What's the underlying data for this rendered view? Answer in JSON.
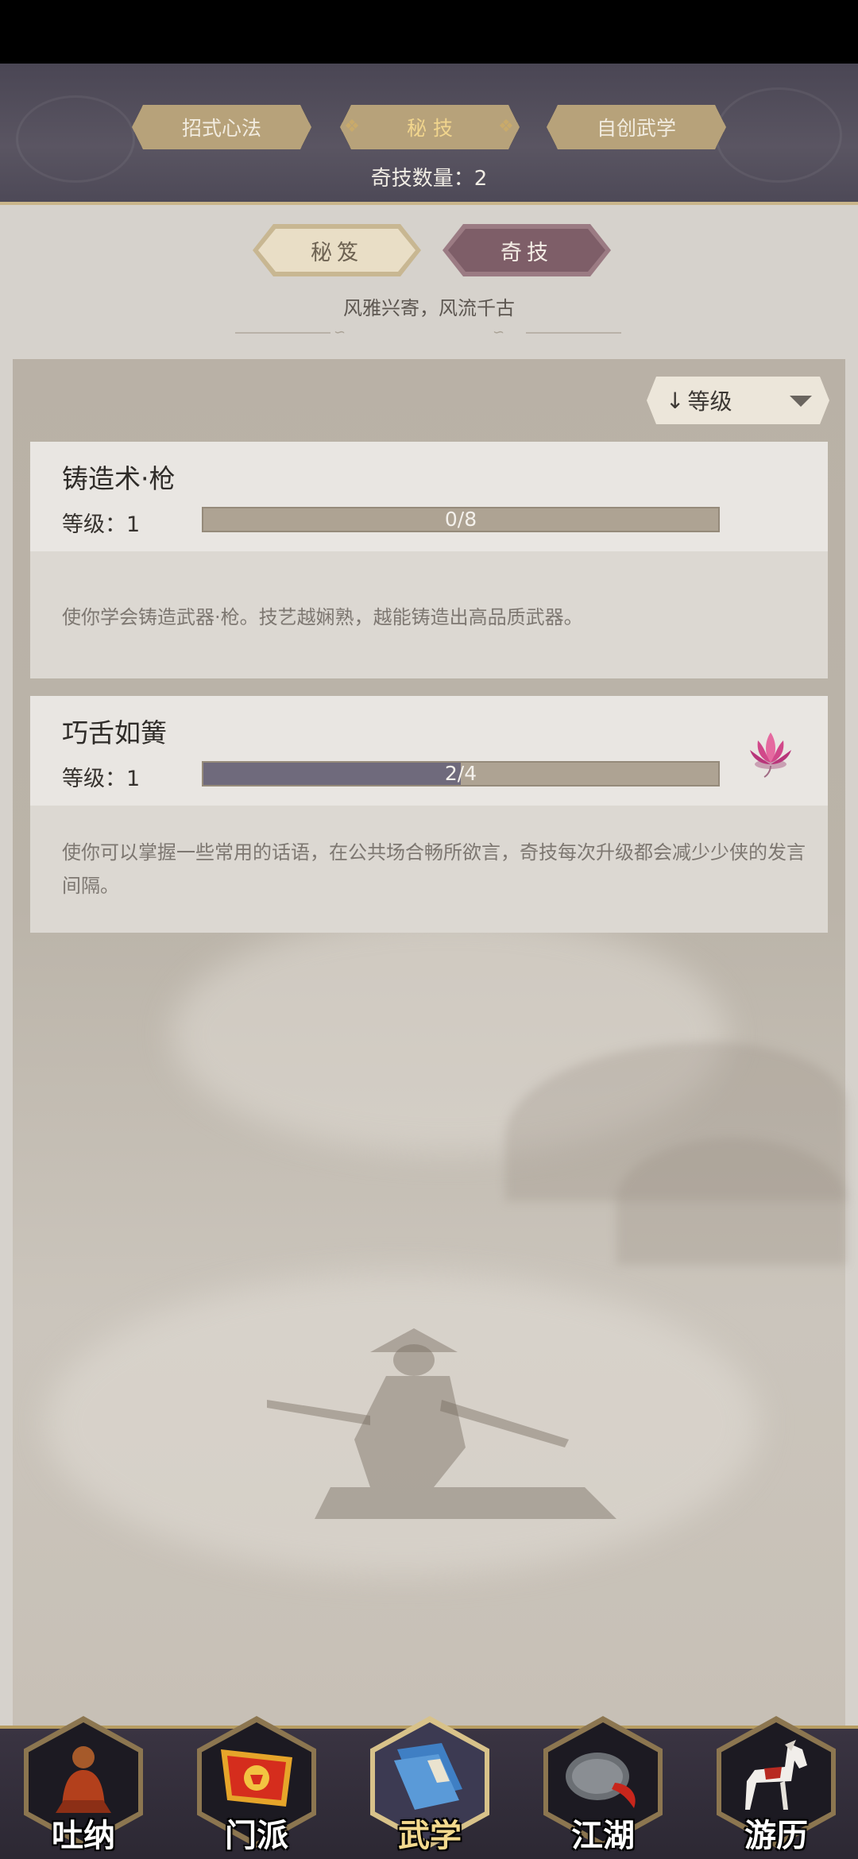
{
  "header": {
    "tabs": [
      {
        "label": "招式心法",
        "active": false
      },
      {
        "label": "秘 技",
        "active": true
      },
      {
        "label": "自创武学",
        "active": false
      }
    ],
    "count_text": "奇技数量：2"
  },
  "sub_tabs": [
    {
      "label": "秘笈",
      "active": false
    },
    {
      "label": "奇技",
      "active": true
    }
  ],
  "subtitle": "风雅兴寄，风流千古",
  "sort": {
    "label": "等级",
    "arrow": "↓"
  },
  "skills": [
    {
      "name": "铸造术·枪",
      "level_text": "等级：1",
      "progress_text": "0/8",
      "progress": 0.0,
      "description": "使你学会铸造武器·枪。技艺越娴熟，越能铸造出高品质武器。",
      "icon": null
    },
    {
      "name": "巧舌如簧",
      "level_text": "等级：1",
      "progress_text": "2/4",
      "progress": 0.5,
      "description": "使你可以掌握一些常用的话语，在公共场合畅所欲言，奇技每次升级都会减少少侠的发言间隔。",
      "icon": "lotus-icon"
    }
  ],
  "bottom_nav": [
    {
      "label": "吐纳",
      "icon": "meditating-monk-icon",
      "active": false
    },
    {
      "label": "门派",
      "icon": "sect-banner-icon",
      "active": false
    },
    {
      "label": "武学",
      "icon": "martial-book-icon",
      "active": true
    },
    {
      "label": "江湖",
      "icon": "bamboo-hat-icon",
      "active": false
    },
    {
      "label": "游历",
      "icon": "horse-icon",
      "active": false
    }
  ],
  "colors": {
    "header_bg": "#4a4654",
    "accent_gold": "#c9b58a",
    "active_subtab": "#7e5e68",
    "progress_fill": "#6f6a7c",
    "progress_track": "#aea393"
  }
}
